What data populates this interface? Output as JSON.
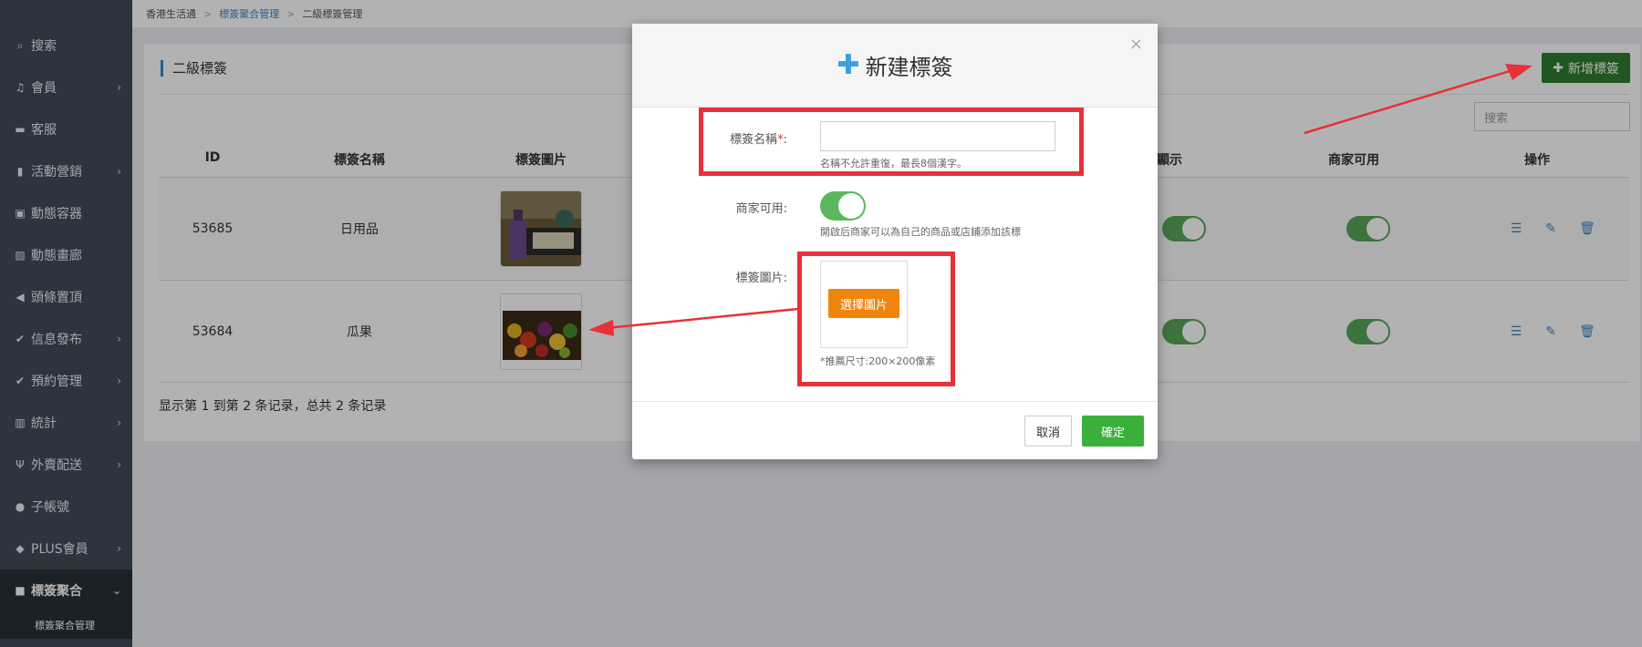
{
  "breadcrumb": {
    "home": "香港生活通",
    "parent": "標簽聚合管理",
    "current": "二級標簽管理"
  },
  "sidebar": {
    "items": [
      {
        "label": "搜索",
        "icon": "search-icon",
        "arrow": false
      },
      {
        "label": "會員",
        "icon": "bell-icon",
        "arrow": true
      },
      {
        "label": "客服",
        "icon": "chat-icon",
        "arrow": false
      },
      {
        "label": "活動營銷",
        "icon": "bookmark-icon",
        "arrow": true
      },
      {
        "label": "動態容器",
        "icon": "container-icon",
        "arrow": false
      },
      {
        "label": "動態畫廊",
        "icon": "image-icon",
        "arrow": false
      },
      {
        "label": "頭條置頂",
        "icon": "megaphone-icon",
        "arrow": false
      },
      {
        "label": "信息發布",
        "icon": "check-icon",
        "arrow": true
      },
      {
        "label": "預約管理",
        "icon": "check-icon",
        "arrow": true
      },
      {
        "label": "統計",
        "icon": "bar-chart-icon",
        "arrow": true
      },
      {
        "label": "外賣配送",
        "icon": "utensils-icon",
        "arrow": true
      },
      {
        "label": "子帳號",
        "icon": "user-icon",
        "arrow": false
      },
      {
        "label": "PLUS會員",
        "icon": "diamond-icon",
        "arrow": true
      },
      {
        "label": "標簽聚合",
        "icon": "square-icon",
        "arrow": "down"
      }
    ],
    "sub_item": "標簽聚合管理"
  },
  "panel": {
    "title": "二級標簽",
    "add_button": "新增標簽",
    "search_placeholder": "搜索",
    "columns": [
      "ID",
      "標簽名稱",
      "標簽圖片",
      "顯示",
      "商家可用",
      "操作"
    ],
    "rows": [
      {
        "id": "53685",
        "name": "日用品",
        "show": true,
        "merchant": true
      },
      {
        "id": "53684",
        "name": "瓜果",
        "show": true,
        "merchant": true
      }
    ],
    "footer": "显示第 1 到第 2 条记录，总共 2 条记录"
  },
  "modal": {
    "title": "新建標簽",
    "close": "×",
    "name_label": "標簽名稱",
    "name_required": "*",
    "name_label_colon": ":",
    "name_value": "",
    "name_help": "名稱不允許重復，最長8個漢字。",
    "merchant_label": "商家可用:",
    "merchant_enabled": true,
    "merchant_help": "開啟后商家可以為自己的商品或店鋪添加該標",
    "image_label": "標簽圖片:",
    "choose_button": "選擇圖片",
    "image_help": "*推薦尺寸:200×200像素",
    "cancel": "取消",
    "confirm": "確定"
  },
  "colors": {
    "sidebar": "#3f4d5a",
    "accent": "#3a87c8",
    "confirm": "#3ab03a",
    "choose": "#f0850c",
    "annotation": "#e8303a"
  }
}
